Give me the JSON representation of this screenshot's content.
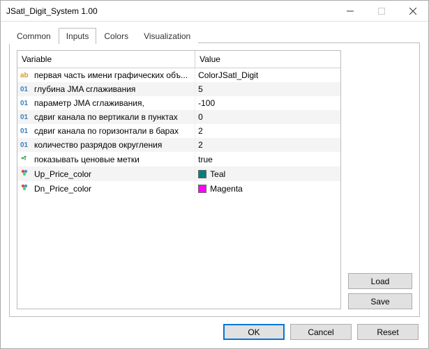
{
  "window": {
    "title": "JSatl_Digit_System 1.00"
  },
  "tabs": [
    {
      "label": "Common"
    },
    {
      "label": "Inputs"
    },
    {
      "label": "Colors"
    },
    {
      "label": "Visualization"
    }
  ],
  "table": {
    "headers": {
      "variable": "Variable",
      "value": "Value"
    },
    "rows": [
      {
        "type": "ab",
        "name": "первая часть имени графических объ...",
        "value": "ColorJSatl_Digit"
      },
      {
        "type": "01",
        "name": "глубина JMA сглаживания",
        "value": "5"
      },
      {
        "type": "01",
        "name": "параметр JMA сглаживания,",
        "value": "-100"
      },
      {
        "type": "01",
        "name": "сдвиг канала по вертикали в пунктах",
        "value": "0"
      },
      {
        "type": "01",
        "name": "сдвиг канала по горизонтали в барах",
        "value": "2"
      },
      {
        "type": "01",
        "name": "количество разрядов округления",
        "value": "2"
      },
      {
        "type": "arrow",
        "name": "показывать ценовые метки",
        "value": "true"
      },
      {
        "type": "cluster",
        "name": "Up_Price_color",
        "value": "Teal",
        "swatch": "#008080"
      },
      {
        "type": "cluster",
        "name": "Dn_Price_color",
        "value": "Magenta",
        "swatch": "#ff00ff"
      }
    ]
  },
  "side_buttons": {
    "load": "Load",
    "save": "Save"
  },
  "bottom_buttons": {
    "ok": "OK",
    "cancel": "Cancel",
    "reset": "Reset"
  }
}
